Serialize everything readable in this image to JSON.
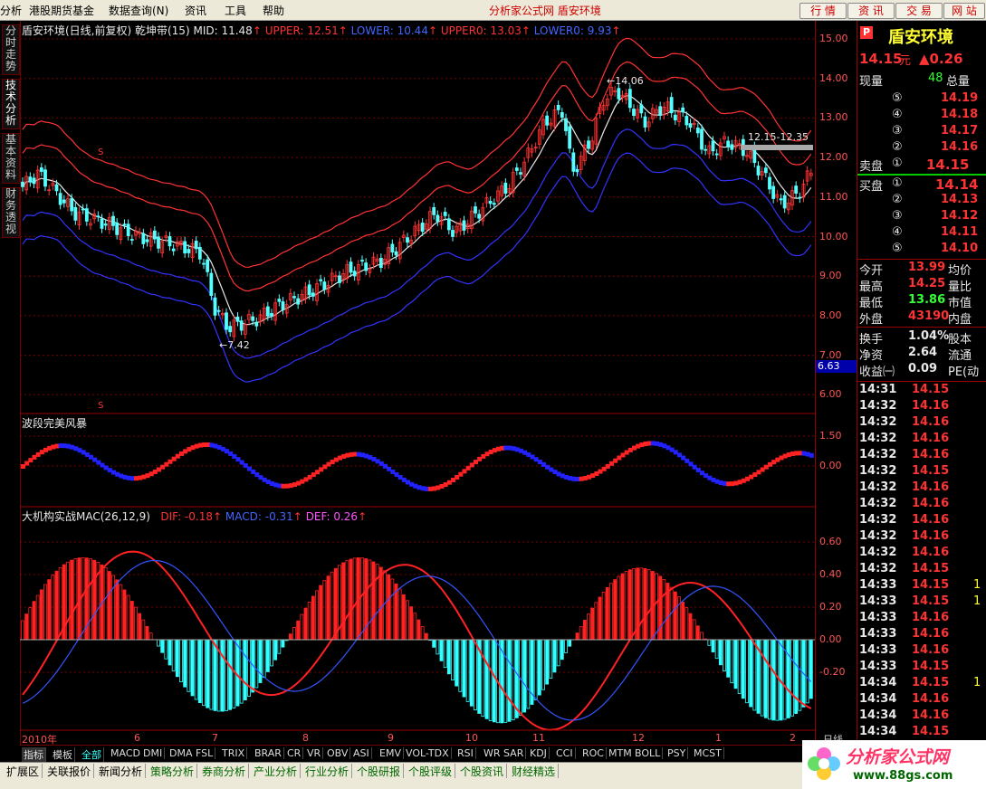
{
  "menu": {
    "items": [
      "分析",
      "港股期货基金",
      "数据查询(N)",
      "资讯",
      "工具",
      "帮助"
    ],
    "center_title": "分析家公式网  盾安环境",
    "buttons": [
      "行 情",
      "资 讯",
      "交 易",
      "网 站"
    ]
  },
  "left_tabs": [
    "分时走势",
    "技术分析",
    "基本资料",
    "财务透视"
  ],
  "main_chart": {
    "title": "盾安环境(日线,前复权) 乾坤带(15)",
    "mid_label": "MID: 11.48",
    "upper_label": "UPPER: 12.51",
    "lower_label": "LOWER: 10.44",
    "upper0_label": "UPPER0: 13.03",
    "lower0_label": "LOWER0: 9.93",
    "high_annotation": "14.06",
    "low_annotation": "7.42",
    "range_annotation": "12.15-12.35",
    "s_marker": "S",
    "axis_ticks": [
      "15.00",
      "14.00",
      "13.00",
      "12.00",
      "11.00",
      "10.00",
      "9.00",
      "8.00",
      "7.00",
      "6.00"
    ],
    "axis_highlight": "6.63",
    "colors": {
      "upper": "#ff3333",
      "lower": "#3333ff",
      "mid": "#e8e8e8",
      "candle_up": "#ff3333",
      "candle_down": "#55ffff"
    }
  },
  "wave_chart": {
    "title": "波段完美风暴",
    "axis_ticks": [
      "1.50",
      "0.75",
      "0.00"
    ]
  },
  "macd_chart": {
    "title": "大机构实战MAC(26,12,9)",
    "dif_label": "DIF: -0.18",
    "macd_label": "MACD: -0.31",
    "def_label": "DEF: 0.26",
    "axis_ticks": [
      "0.60",
      "0.40",
      "0.20",
      "0.00",
      "-0.20"
    ]
  },
  "x_axis": {
    "labels": [
      "2010年",
      "6",
      "7",
      "8",
      "9",
      "10",
      "11",
      "12",
      "1",
      "2"
    ],
    "mode_label": "日线"
  },
  "quote": {
    "stock_name": "盾安环境",
    "price": "14.15",
    "price_unit": "元",
    "change": "▲0.26",
    "volume_label": "现量",
    "volume_value": "48",
    "total_label": "总量",
    "sell_label": "卖盘",
    "buy_label": "买盘",
    "sell_orders": [
      {
        "level": "⑤",
        "price": "14.19"
      },
      {
        "level": "④",
        "price": "14.18"
      },
      {
        "level": "③",
        "price": "14.17"
      },
      {
        "level": "②",
        "price": "14.16"
      },
      {
        "level": "①",
        "price": "14.15"
      }
    ],
    "buy_orders": [
      {
        "level": "①",
        "price": "14.14"
      },
      {
        "level": "②",
        "price": "14.13"
      },
      {
        "level": "③",
        "price": "14.12"
      },
      {
        "level": "④",
        "price": "14.11"
      },
      {
        "level": "⑤",
        "price": "14.10"
      }
    ],
    "stats": [
      {
        "label": "今开",
        "value": "13.99",
        "label2": "均价"
      },
      {
        "label": "最高",
        "value": "14.25",
        "label2": "量比"
      },
      {
        "label": "最低",
        "value": "13.86",
        "label2": "市值"
      },
      {
        "label": "外盘",
        "value": "43190",
        "label2": "内盘"
      }
    ],
    "stats2": [
      {
        "label": "换手",
        "value": "1.04%",
        "label2": "股本"
      },
      {
        "label": "净资",
        "value": "2.64",
        "label2": "流通"
      },
      {
        "label": "收益㈠",
        "value": "0.09",
        "label2": "PE(动"
      }
    ],
    "ticks": [
      {
        "time": "14:31",
        "price": "14.15",
        "vol": ""
      },
      {
        "time": "14:32",
        "price": "14.16",
        "vol": ""
      },
      {
        "time": "14:32",
        "price": "14.16",
        "vol": ""
      },
      {
        "time": "14:32",
        "price": "14.16",
        "vol": ""
      },
      {
        "time": "14:32",
        "price": "14.16",
        "vol": ""
      },
      {
        "time": "14:32",
        "price": "14.15",
        "vol": ""
      },
      {
        "time": "14:32",
        "price": "14.16",
        "vol": ""
      },
      {
        "time": "14:32",
        "price": "14.16",
        "vol": ""
      },
      {
        "time": "14:32",
        "price": "14.16",
        "vol": ""
      },
      {
        "time": "14:32",
        "price": "14.16",
        "vol": ""
      },
      {
        "time": "14:32",
        "price": "14.16",
        "vol": ""
      },
      {
        "time": "14:32",
        "price": "14.15",
        "vol": ""
      },
      {
        "time": "14:33",
        "price": "14.15",
        "vol": "1"
      },
      {
        "time": "14:33",
        "price": "14.15",
        "vol": "1"
      },
      {
        "time": "14:33",
        "price": "14.16",
        "vol": ""
      },
      {
        "time": "14:33",
        "price": "14.16",
        "vol": ""
      },
      {
        "time": "14:33",
        "price": "14.16",
        "vol": ""
      },
      {
        "time": "14:33",
        "price": "14.15",
        "vol": ""
      },
      {
        "time": "14:34",
        "price": "14.15",
        "vol": "1"
      },
      {
        "time": "14:34",
        "price": "14.16",
        "vol": ""
      },
      {
        "time": "14:34",
        "price": "14.16",
        "vol": ""
      },
      {
        "time": "14:34",
        "price": "14.15",
        "vol": ""
      },
      {
        "time": "14:34",
        "price": "14.16",
        "vol": ""
      }
    ]
  },
  "indicator_bar": [
    "指标",
    "模板",
    "全部",
    "MACD",
    "DMI",
    "DMA",
    "FSL",
    "TRIX",
    "BRAR",
    "CR",
    "VR",
    "OBV",
    "ASI",
    "EMV",
    "VOL-TDX",
    "RSI",
    "WR",
    "SAR",
    "KDJ",
    "CCI",
    "ROC",
    "MTM",
    "BOLL",
    "PSY",
    "MCST"
  ],
  "bottom_bar": [
    "扩展区",
    "关联报价",
    "新闻分析",
    "策略分析",
    "券商分析",
    "产业分析",
    "行业分析",
    "个股研报",
    "个股评级",
    "个股资讯",
    "财经精选"
  ],
  "logo": {
    "text": "分析家公式网",
    "url_text": "www.88gs.com"
  }
}
